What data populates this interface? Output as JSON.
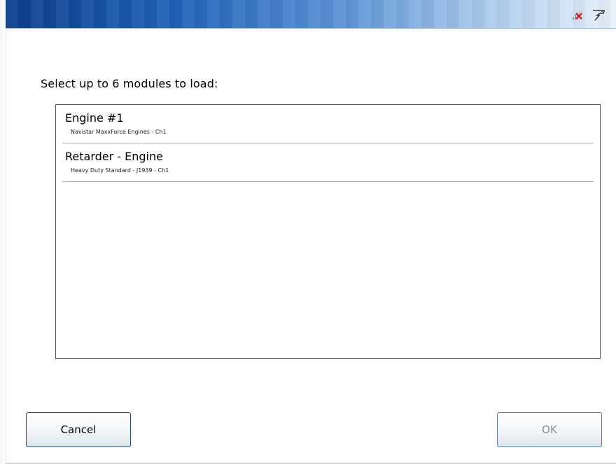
{
  "header": {
    "icons": [
      "signal-error-icon",
      "connector-icon"
    ],
    "colors": {
      "gradient_start": "#0c3e8c",
      "gradient_end": "#e8f1fb"
    }
  },
  "main": {
    "prompt": "Select up to 6 modules to load:",
    "modules": [
      {
        "name": "Engine #1",
        "description": "Navistar MaxxForce Engines - Ch1"
      },
      {
        "name": "Retarder - Engine",
        "description": "Heavy Duty Standard - J1939 - Ch1"
      }
    ]
  },
  "footer": {
    "cancel_label": "Cancel",
    "ok_label": "OK"
  }
}
